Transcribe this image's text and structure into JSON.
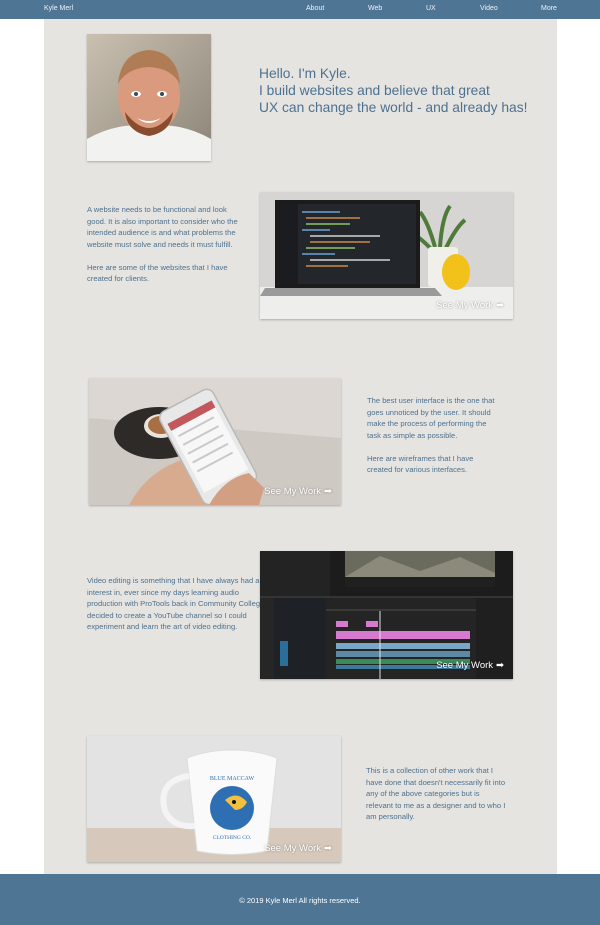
{
  "header": {
    "brand": "Kyle Merl",
    "nav": [
      "About",
      "Web",
      "UX",
      "Video",
      "More"
    ]
  },
  "hero": {
    "lines": [
      "Hello.  I'm Kyle.",
      "I build websites and believe that great",
      "UX can change the world - and already has!"
    ],
    "portrait_alt": "Kyle portrait photo"
  },
  "sections": [
    {
      "paragraphs": [
        "A website needs to be functional and look good.  It is also important to consider who the intended audience is and what problems the website must solve and needs it must fulfill.",
        "Here are some of the websites that I have created for clients."
      ],
      "link": "See My Work",
      "arrow": "➡"
    },
    {
      "paragraphs": [
        "The best user interface is the one that goes unnoticed by the user.  It should make the process of performing the task as simple as possible.",
        "Here are wireframes that I have created for various interfaces."
      ],
      "link": "See My Work",
      "arrow": "➡"
    },
    {
      "paragraphs": [
        "Video editing is something that I have always had an interest in, ever since my days learning audio production with ProTools back in Community College.  I decided to create a YouTube channel so I could experiment and learn the art of video editing."
      ],
      "link": "See My Work",
      "arrow": "➡"
    },
    {
      "paragraphs": [
        "This is a collection of other work that I have done that doesn't necessarily fit into any of the above categories but is relevant to me as a designer and to who I am personally."
      ],
      "link": "See My Work",
      "arrow": "➡"
    }
  ],
  "mug": {
    "brand_top": "BLUE MACCAW",
    "brand_bottom": "CLOTHING CO."
  },
  "footer": {
    "text": "© 2019 Kyle Merl All rights reserved."
  },
  "colors": {
    "nav_bg": "#4f7595",
    "panel_bg": "#e6e4e0",
    "text": "#4d7190"
  }
}
